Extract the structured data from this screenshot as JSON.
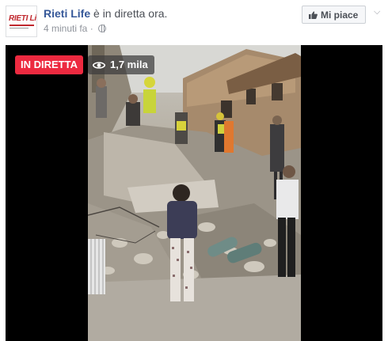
{
  "post": {
    "page_name": "Rieti Life",
    "status": " è in diretta ora.",
    "timestamp": "4 minuti fa",
    "audience_icon": "globe-icon",
    "logo_text": "RIETI Life"
  },
  "actions": {
    "like_label": "Mi piace",
    "like_icon": "thumbs-up-icon",
    "menu_icon": "chevron-down-icon"
  },
  "video": {
    "live_label": "IN DIRETTA",
    "viewers_label": "1,7 mila",
    "viewers_icon": "eye-icon",
    "live_color": "#ed2a40"
  }
}
